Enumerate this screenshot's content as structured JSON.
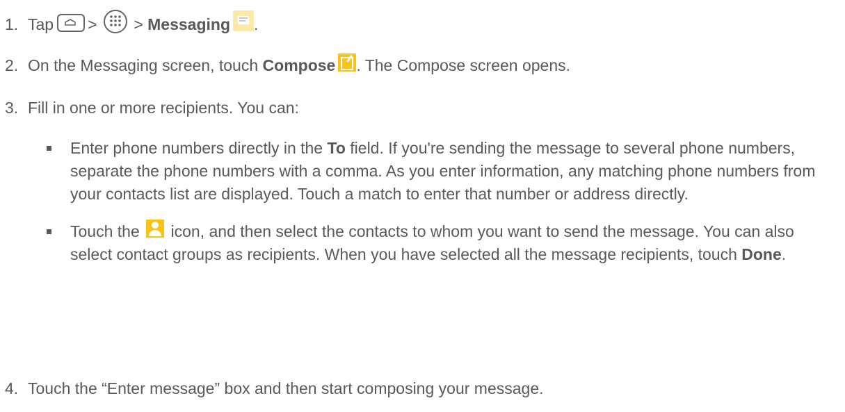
{
  "steps": [
    {
      "number": "1.",
      "parts": {
        "tap": "Tap",
        "sep1": ">",
        "sep2": ">",
        "app": "Messaging",
        "end": "."
      },
      "icons": [
        "home-icon",
        "apps-icon",
        "messaging-app-icon"
      ]
    },
    {
      "number": "2.",
      "parts": {
        "lead": "On the Messaging screen, touch",
        "bold": "Compose",
        "tail": ". The Compose screen opens."
      },
      "icons": [
        "compose-icon"
      ]
    },
    {
      "number": "3.",
      "text": "Fill in one or more recipients. You can:",
      "bullets": [
        {
          "lead": "Enter phone numbers directly in the",
          "bold": "To",
          "tail": "field. If you're sending the message to several phone numbers, separate the phone numbers with a comma. As you enter information, any matching phone numbers from your contacts list are displayed. Touch a match to enter that number or address directly."
        },
        {
          "lead": "Touch the",
          "icon": "contact-icon",
          "middle": "icon, and then select the contacts to whom you want to send the message. You can also select contact groups as recipients. When you have selected all the message recipients, touch",
          "bold": "Done",
          "tail": "."
        }
      ]
    },
    {
      "number": "4.",
      "text": "Touch the “Enter message” box and then start composing your message."
    }
  ],
  "colors": {
    "text": "#595959",
    "icon_yellow": "#f7c417",
    "messaging_icon_bg": "#fbe9a9"
  }
}
